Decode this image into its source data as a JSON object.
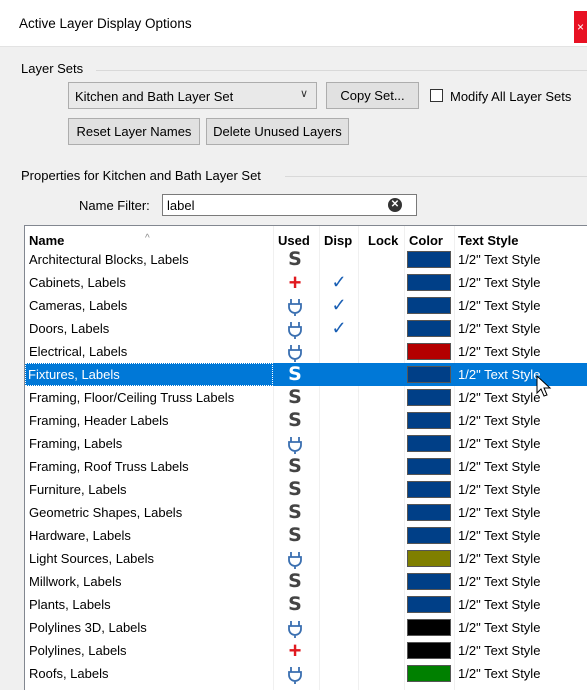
{
  "window": {
    "title": "Active Layer Display Options",
    "close_glyph": "×"
  },
  "layer_sets": {
    "group_label": "Layer Sets",
    "selected_set": "Kitchen and Bath Layer Set",
    "copy_button": "Copy Set...",
    "modify_all_label": "Modify All Layer Sets",
    "modify_all_checked": false,
    "reset_button": "Reset Layer Names",
    "delete_button": "Delete Unused Layers"
  },
  "properties": {
    "group_label": "Properties for Kitchen and Bath Layer Set",
    "filter_label": "Name Filter:",
    "filter_value": "label"
  },
  "table": {
    "columns": [
      "Name",
      "Used",
      "Disp",
      "Lock",
      "Color",
      "Text Style"
    ],
    "rows": [
      {
        "name": "Architectural Blocks, Labels",
        "used": "S",
        "disp": false,
        "color": "#003f87",
        "text_style": "1/2\" Text Style"
      },
      {
        "name": "Cabinets, Labels",
        "used": "+",
        "disp": true,
        "color": "#003f87",
        "text_style": "1/2\" Text Style"
      },
      {
        "name": "Cameras, Labels",
        "used": "plug",
        "disp": true,
        "color": "#003f87",
        "text_style": "1/2\" Text Style"
      },
      {
        "name": "Doors, Labels",
        "used": "plug",
        "disp": true,
        "color": "#003f87",
        "text_style": "1/2\" Text Style"
      },
      {
        "name": "Electrical, Labels",
        "used": "plug",
        "disp": false,
        "color": "#b40000",
        "text_style": "1/2\" Text Style"
      },
      {
        "name": "Fixtures, Labels",
        "used": "S",
        "disp": false,
        "color": "#003f87",
        "text_style": "1/2\" Text Style",
        "selected": true
      },
      {
        "name": "Framing, Floor/Ceiling Truss Labels",
        "used": "S",
        "disp": false,
        "color": "#003f87",
        "text_style": "1/2\" Text Style"
      },
      {
        "name": "Framing, Header Labels",
        "used": "S",
        "disp": false,
        "color": "#003f87",
        "text_style": "1/2\" Text Style"
      },
      {
        "name": "Framing, Labels",
        "used": "plug",
        "disp": false,
        "color": "#003f87",
        "text_style": "1/2\" Text Style"
      },
      {
        "name": "Framing, Roof Truss Labels",
        "used": "S",
        "disp": false,
        "color": "#003f87",
        "text_style": "1/2\" Text Style"
      },
      {
        "name": "Furniture, Labels",
        "used": "S",
        "disp": false,
        "color": "#003f87",
        "text_style": "1/2\" Text Style"
      },
      {
        "name": "Geometric Shapes, Labels",
        "used": "S",
        "disp": false,
        "color": "#003f87",
        "text_style": "1/2\" Text Style"
      },
      {
        "name": "Hardware, Labels",
        "used": "S",
        "disp": false,
        "color": "#003f87",
        "text_style": "1/2\" Text Style"
      },
      {
        "name": "Light Sources, Labels",
        "used": "plug",
        "disp": false,
        "color": "#7f7f00",
        "text_style": "1/2\" Text Style"
      },
      {
        "name": "Millwork, Labels",
        "used": "S",
        "disp": false,
        "color": "#003f87",
        "text_style": "1/2\" Text Style"
      },
      {
        "name": "Plants, Labels",
        "used": "S",
        "disp": false,
        "color": "#003f87",
        "text_style": "1/2\" Text Style"
      },
      {
        "name": "Polylines 3D, Labels",
        "used": "plug",
        "disp": false,
        "color": "#000000",
        "text_style": "1/2\" Text Style"
      },
      {
        "name": "Polylines, Labels",
        "used": "+",
        "disp": false,
        "color": "#000000",
        "text_style": "1/2\" Text Style"
      },
      {
        "name": "Roofs, Labels",
        "used": "plug",
        "disp": false,
        "color": "#008000",
        "text_style": "1/2\" Text Style"
      }
    ]
  }
}
